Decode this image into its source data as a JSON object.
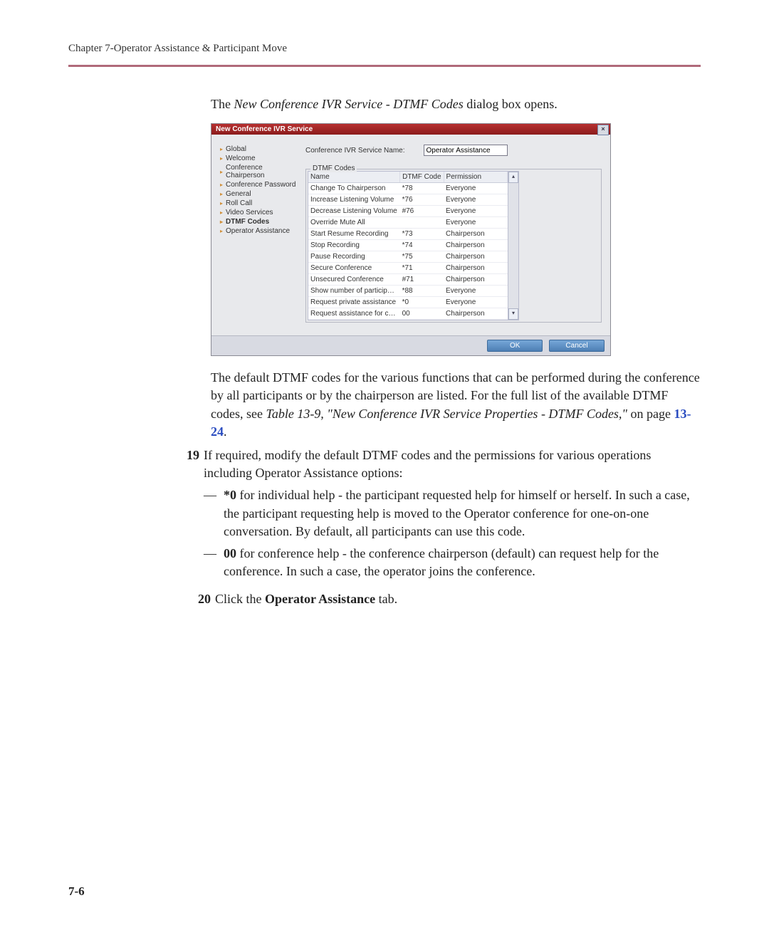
{
  "header": {
    "chapter_line": "Chapter 7-Operator Assistance & Participant Move"
  },
  "intro": {
    "prefix": "The ",
    "italic": "New Conference IVR Service - DTMF Codes",
    "suffix": " dialog box opens."
  },
  "dialog": {
    "title": "New Conference IVR Service",
    "close": "×",
    "nav": [
      {
        "label": "Global",
        "active": false
      },
      {
        "label": "Welcome",
        "active": false
      },
      {
        "label": "Conference Chairperson",
        "active": false
      },
      {
        "label": "Conference Password",
        "active": false
      },
      {
        "label": "General",
        "active": false
      },
      {
        "label": "Roll Call",
        "active": false
      },
      {
        "label": "Video Services",
        "active": false
      },
      {
        "label": "DTMF Codes",
        "active": true
      },
      {
        "label": "Operator Assistance",
        "active": false
      }
    ],
    "service_name_label": "Conference IVR Service Name:",
    "service_name_value": "Operator Assistance",
    "legend": "DTMF Codes",
    "columns": {
      "name": "Name",
      "code": "DTMF Code",
      "perm": "Permission"
    },
    "rows": [
      {
        "name": "Change To Chairperson",
        "code": "*78",
        "perm": "Everyone"
      },
      {
        "name": "Increase Listening Volume",
        "code": "*76",
        "perm": "Everyone"
      },
      {
        "name": "Decrease Listening Volume",
        "code": "#76",
        "perm": "Everyone"
      },
      {
        "name": "Override Mute All",
        "code": "",
        "perm": "Everyone"
      },
      {
        "name": "Start Resume Recording",
        "code": "*73",
        "perm": "Chairperson"
      },
      {
        "name": "Stop Recording",
        "code": "*74",
        "perm": "Chairperson"
      },
      {
        "name": "Pause Recording",
        "code": "*75",
        "perm": "Chairperson"
      },
      {
        "name": "Secure Conference",
        "code": "*71",
        "perm": "Chairperson"
      },
      {
        "name": "Unsecured Conference",
        "code": "#71",
        "perm": "Chairperson"
      },
      {
        "name": "Show number of participants",
        "code": "*88",
        "perm": "Everyone"
      },
      {
        "name": "Request private assistance",
        "code": "*0",
        "perm": "Everyone"
      },
      {
        "name": "Request assistance for confer",
        "code": "00",
        "perm": "Chairperson"
      }
    ],
    "ok": "OK",
    "cancel": "Cancel"
  },
  "para2": {
    "t1": "The default DTMF codes for the various functions that can be performed during the conference by all participants or by the chairperson are listed. For the full list of the available DTMF codes, see  ",
    "ref": "Table 13-9, \"New Conference IVR Service Properties - DTMF Codes,\"",
    "t2": " on page ",
    "pg": "13-24",
    "t3": "."
  },
  "step19": {
    "num": "19",
    "lead": "If required, modify the default DTMF codes and the permissions for various operations including Operator Assistance options:",
    "b1_code": "*0",
    "b1_rest": " for individual help - the participant requested help for himself or herself. In such a case, the participant requesting help is moved to the Operator conference for one-on-one conversation. By default, all participants can use this code.",
    "b2_code": "00",
    "b2_rest": " for conference help - the conference chairperson (default) can request help for the conference. In such a case, the operator joins the conference."
  },
  "step20": {
    "num": "20",
    "t1": "Click the ",
    "bold": "Operator Assistance",
    "t2": " tab."
  },
  "page_num": "7-6",
  "dash": "—"
}
